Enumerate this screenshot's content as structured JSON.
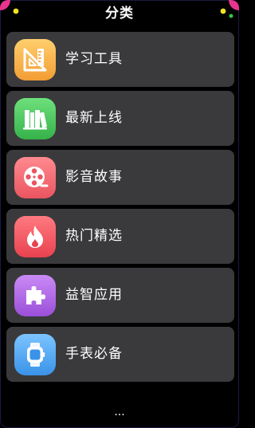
{
  "header": {
    "title": "分类"
  },
  "categories": [
    {
      "label": "学习工具",
      "icon": "ruler-triangle-icon",
      "color": "#f7b24f"
    },
    {
      "label": "最新上线",
      "icon": "books-icon",
      "color": "#46c25a"
    },
    {
      "label": "影音故事",
      "icon": "film-reel-icon",
      "color": "#f06a72"
    },
    {
      "label": "热门精选",
      "icon": "flame-icon",
      "color": "#ef5865"
    },
    {
      "label": "益智应用",
      "icon": "puzzle-icon",
      "color": "#a85ee0"
    },
    {
      "label": "手表必备",
      "icon": "watch-icon",
      "color": "#4aa5f0"
    }
  ],
  "footer": {
    "more": "..."
  }
}
